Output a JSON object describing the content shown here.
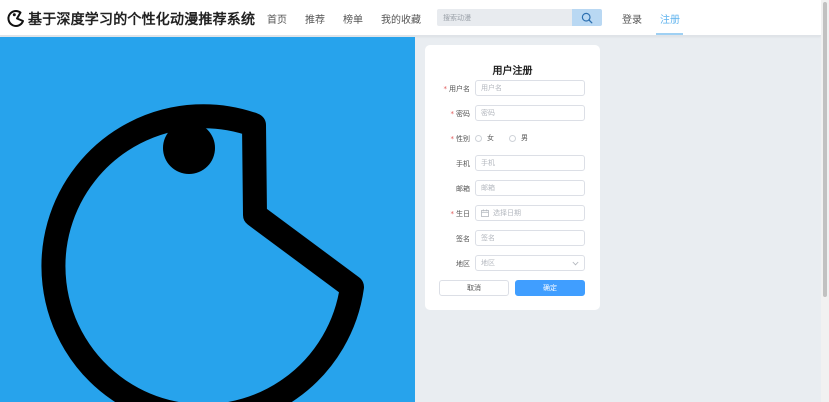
{
  "app": {
    "title": "基于深度学习的个性化动漫推荐系统"
  },
  "nav": {
    "home": "首页",
    "recommend": "推荐",
    "ranking": "榜单",
    "favorites": "我的收藏",
    "login": "登录",
    "register": "注册"
  },
  "search": {
    "placeholder": "搜索动漫",
    "value": ""
  },
  "form": {
    "title": "用户注册",
    "username_label": "用户名",
    "username_placeholder": "用户名",
    "password_label": "密码",
    "password_placeholder": "密码",
    "gender_label": "性别",
    "gender_female": "女",
    "gender_male": "男",
    "phone_label": "手机",
    "phone_placeholder": "手机",
    "email_label": "邮箱",
    "email_placeholder": "邮箱",
    "birthday_label": "生日",
    "birthday_placeholder": "选择日期",
    "signature_label": "签名",
    "signature_placeholder": "签名",
    "region_label": "地区",
    "region_placeholder": "地区",
    "cancel_label": "取消",
    "confirm_label": "确定",
    "required_mark": "*"
  },
  "colors": {
    "hero_background": "#27a3ec",
    "primary": "#409eff",
    "active_nav": "#5fb3ee",
    "required": "#e05a5a"
  },
  "icons": {
    "logo": "pacman-logo-icon",
    "search": "search-icon",
    "calendar": "calendar-icon",
    "dropdown": "chevron-down-icon",
    "hero": "pacman-illustration"
  }
}
